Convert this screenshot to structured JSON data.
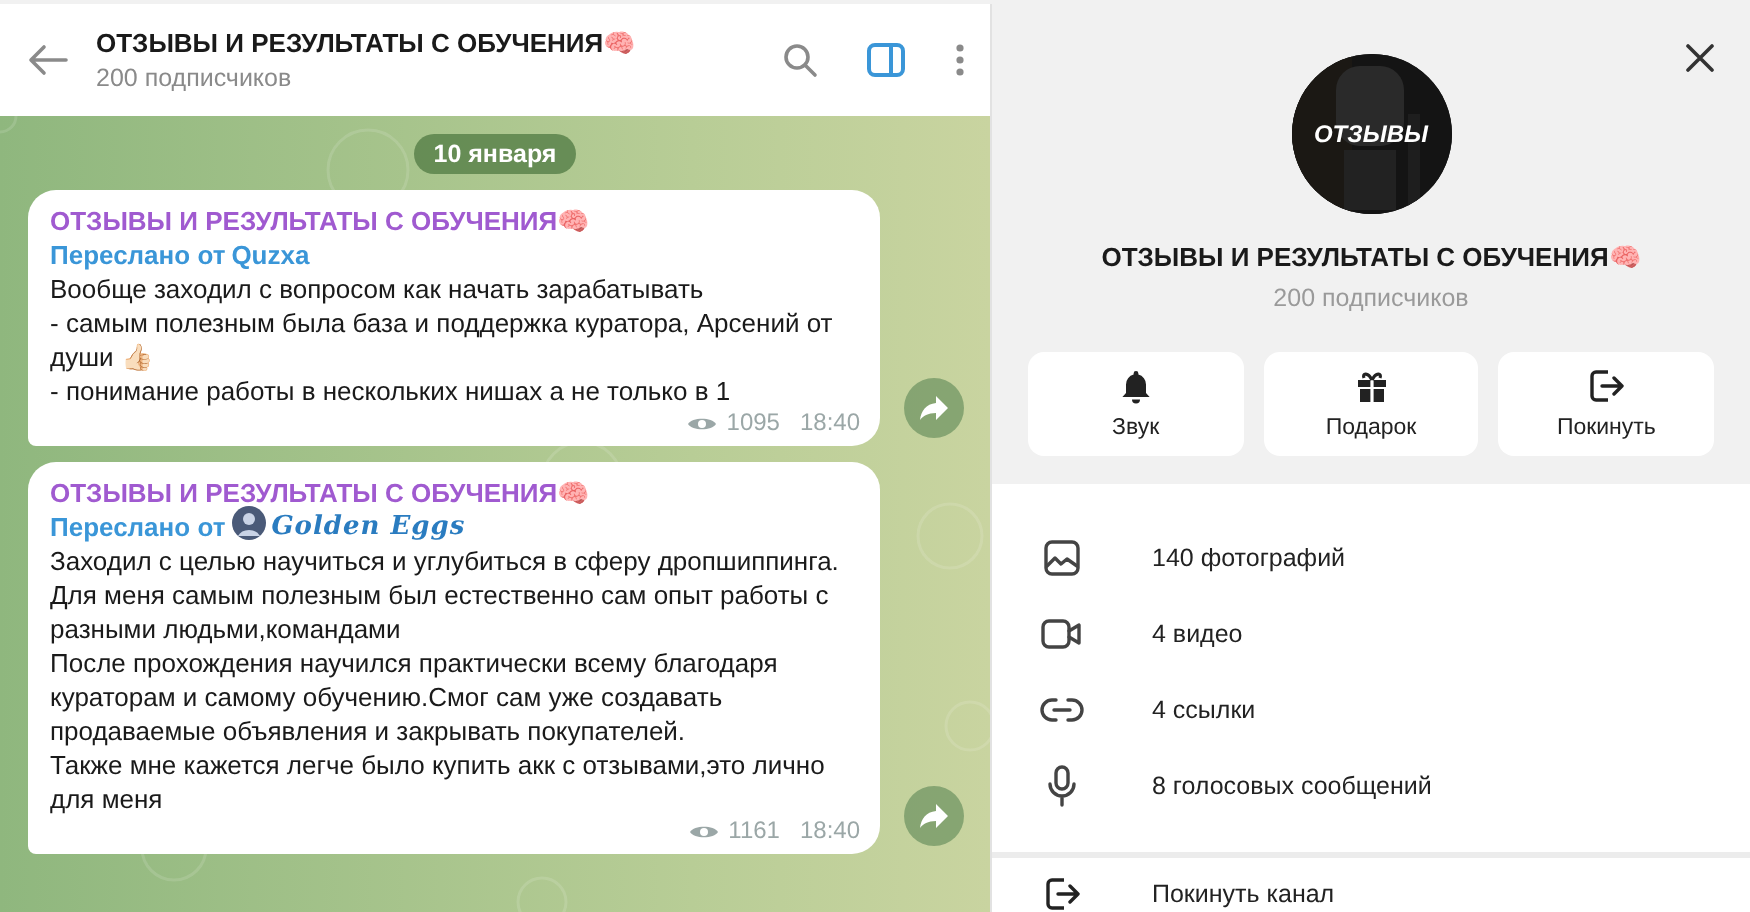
{
  "chat_header": {
    "title": "ОТЗЫВЫ И РЕЗУЛЬТАТЫ С ОБУЧЕНИЯ🧠",
    "subtitle": "200 подписчиков"
  },
  "date_badge": "10 января",
  "messages": [
    {
      "channel": "ОТЗЫВЫ И РЕЗУЛЬТАТЫ С ОБУЧЕНИЯ🧠",
      "forwarded_label": "Переслано от",
      "forwarded_from": "Quzxa",
      "from_avatar": false,
      "fancy_name": false,
      "text": "Вообще заходил с вопросом как начать зарабатывать\n- самым полезным была база и поддержка куратора, Арсений от души 👍🏻\n- понимание работы в нескольких нишах а не только в 1",
      "views": "1095",
      "time": "18:40"
    },
    {
      "channel": "ОТЗЫВЫ И РЕЗУЛЬТАТЫ С ОБУЧЕНИЯ🧠",
      "forwarded_label": "Переслано от",
      "forwarded_from": "Golden Eggs",
      "from_avatar": true,
      "fancy_name": true,
      "text": "Заходил с целью научиться и углубиться в сферу дропшиппинга.\nДля меня самым полезным был естественно сам опыт работы с разными людьми,командами\nПосле прохождения научился практически всему благодаря кураторам и самому обучению.Смог сам уже создавать продаваемые объявления и закрывать покупателей.\nТакже мне кажется легче было купить акк с отзывами,это лично для меня",
      "views": "1161",
      "time": "18:40"
    }
  ],
  "profile": {
    "avatar_text": "ОТЗЫВЫ",
    "title": "ОТЗЫВЫ И РЕЗУЛЬТАТЫ С ОБУЧЕНИЯ🧠",
    "subtitle": "200 подписчиков",
    "actions": [
      {
        "kind": "bell",
        "label": "Звук"
      },
      {
        "kind": "gift",
        "label": "Подарок"
      },
      {
        "kind": "leave",
        "label": "Покинуть"
      }
    ]
  },
  "media": [
    {
      "label": "140 фотографий"
    },
    {
      "kind": "video",
      "label": "4 видео"
    },
    {
      "kind": "link",
      "label": "4 ссылки"
    },
    {
      "kind": "voice",
      "label": "8 голосовых сообщений"
    }
  ],
  "leave": {
    "kind": "leave",
    "label": "Покинуть канал"
  }
}
